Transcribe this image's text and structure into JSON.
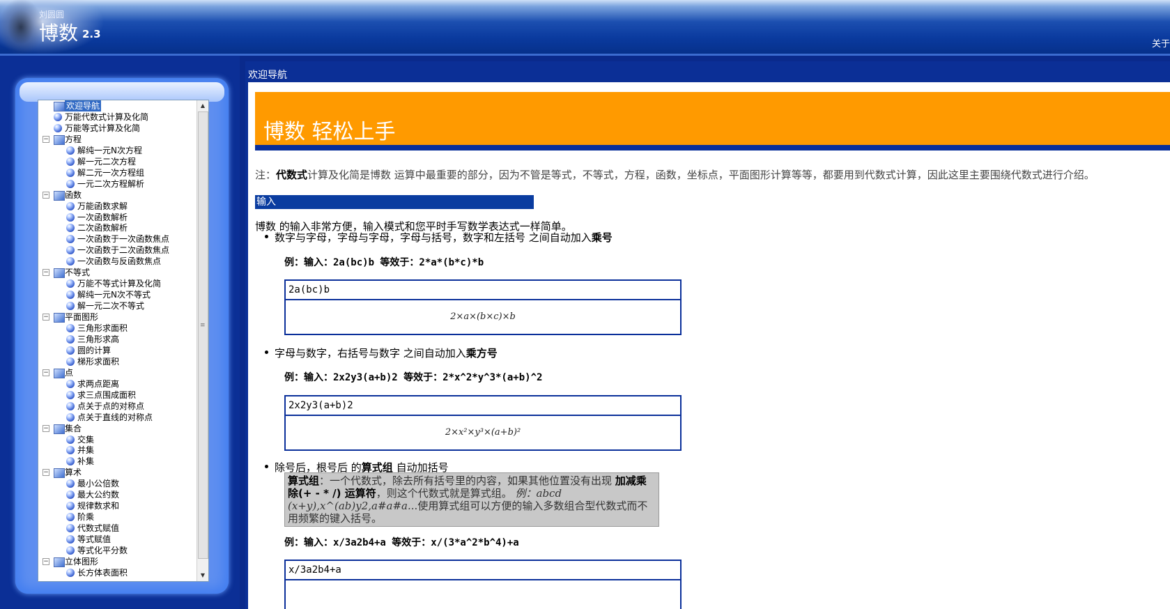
{
  "header": {
    "author": "刘圆圆",
    "title": "博数",
    "version": "2.3",
    "about": "关于"
  },
  "sidebar": {
    "items": [
      {
        "label": "欢迎导航",
        "type": "root",
        "selected": true
      },
      {
        "label": "万能代数式计算及化简",
        "type": "leaf1"
      },
      {
        "label": "万能等式计算及化简",
        "type": "leaf1"
      },
      {
        "label": "方程",
        "type": "category"
      },
      {
        "label": "解纯一元N次方程",
        "type": "leaf2"
      },
      {
        "label": "解一元二次方程",
        "type": "leaf2"
      },
      {
        "label": "解二元一次方程组",
        "type": "leaf2"
      },
      {
        "label": "一元二次方程解析",
        "type": "leaf2"
      },
      {
        "label": "函数",
        "type": "category"
      },
      {
        "label": "万能函数求解",
        "type": "leaf2"
      },
      {
        "label": "一次函数解析",
        "type": "leaf2"
      },
      {
        "label": "二次函数解析",
        "type": "leaf2"
      },
      {
        "label": "一次函数于一次函数焦点",
        "type": "leaf2"
      },
      {
        "label": "一次函数于二次函数焦点",
        "type": "leaf2"
      },
      {
        "label": "一次函数与反函数焦点",
        "type": "leaf2"
      },
      {
        "label": "不等式",
        "type": "category"
      },
      {
        "label": "万能不等式计算及化简",
        "type": "leaf2"
      },
      {
        "label": "解纯一元N次不等式",
        "type": "leaf2"
      },
      {
        "label": "解一元二次不等式",
        "type": "leaf2"
      },
      {
        "label": "平面图形",
        "type": "category"
      },
      {
        "label": "三角形求面积",
        "type": "leaf2"
      },
      {
        "label": "三角形求高",
        "type": "leaf2"
      },
      {
        "label": "圆的计算",
        "type": "leaf2"
      },
      {
        "label": "梯形求面积",
        "type": "leaf2"
      },
      {
        "label": "点",
        "type": "category"
      },
      {
        "label": "求两点距离",
        "type": "leaf2"
      },
      {
        "label": "求三点围成面积",
        "type": "leaf2"
      },
      {
        "label": "点关于点的对称点",
        "type": "leaf2"
      },
      {
        "label": "点关于直线的对称点",
        "type": "leaf2"
      },
      {
        "label": "集合",
        "type": "category"
      },
      {
        "label": "交集",
        "type": "leaf2"
      },
      {
        "label": "并集",
        "type": "leaf2"
      },
      {
        "label": "补集",
        "type": "leaf2"
      },
      {
        "label": "算术",
        "type": "category"
      },
      {
        "label": "最小公倍数",
        "type": "leaf2"
      },
      {
        "label": "最大公约数",
        "type": "leaf2"
      },
      {
        "label": "规律数求和",
        "type": "leaf2"
      },
      {
        "label": "阶乘",
        "type": "leaf2"
      },
      {
        "label": "代数式赋值",
        "type": "leaf2"
      },
      {
        "label": "等式赋值",
        "type": "leaf2"
      },
      {
        "label": "等式化平分数",
        "type": "leaf2"
      },
      {
        "label": "立体图形",
        "type": "category"
      },
      {
        "label": "长方体表面积",
        "type": "leaf2"
      }
    ]
  },
  "content": {
    "title": "欢迎导航",
    "banner": "博数  轻松上手",
    "note_prefix": "注：",
    "note_bold": "代数式",
    "note_rest": "计算及化简是博数 运算中最重要的部分，因为不管是等式，不等式，方程，函数，坐标点，平面图形计算等等，都要用到代数式计算，因此这里主要围绕代数式进行介绍。",
    "section_input": "输入",
    "intro": "博数 的输入非常方便，输入模式和您平时手写数学表达式一样简单。",
    "bullet1_text": "数字与字母，字母与字母，字母与括号，数字和左括号 之间自动加入",
    "bullet1_bold": "乘号",
    "example1": "例：输入：2a(bc)b 等效于：2*a*(b*c)*b",
    "demo1_input": "2a(bc)b",
    "demo1_output": "2×a×(b×c)×b",
    "bullet2_text": "字母与数字，右括号与数字 之间自动加入",
    "bullet2_bold": "乘方号",
    "example2": "例：输入：2x2y3(a+b)2 等效于：2*x^2*y^3*(a+b)^2",
    "demo2_input": "2x2y3(a+b)2",
    "demo2_output": "2×x²×y³×(a+b)²",
    "bullet3_text1": "除号后，根号后 的",
    "bullet3_bold": "算式组",
    "bullet3_text2": " 自动加括号",
    "notebox_bold1": "算式组",
    "notebox_text1": "：一个代数式，除去所有括号里的内容，如果其他位置没有出现 ",
    "notebox_bold2": "加减乘除(+ - * /) 运算符",
    "notebox_text2": "，则这个代数式就是算式组。 ",
    "notebox_italic": "例：abcd (x+y),x^(ab)y2,a#a#a..",
    "notebox_text3": ".使用算式组可以方便的输入多数组合型代数式而不用频繁的键入括号。",
    "example3": "例：输入：x/3a2b4+a 等效于：x/(3*a^2*b^4)+a",
    "demo3_input": "x/3a2b4+a"
  },
  "colors": {
    "header_blue": "#0a3a9e",
    "banner_orange": "#ff9a00",
    "section_blue": "#0a3ca0",
    "selected": "#316ac5"
  }
}
